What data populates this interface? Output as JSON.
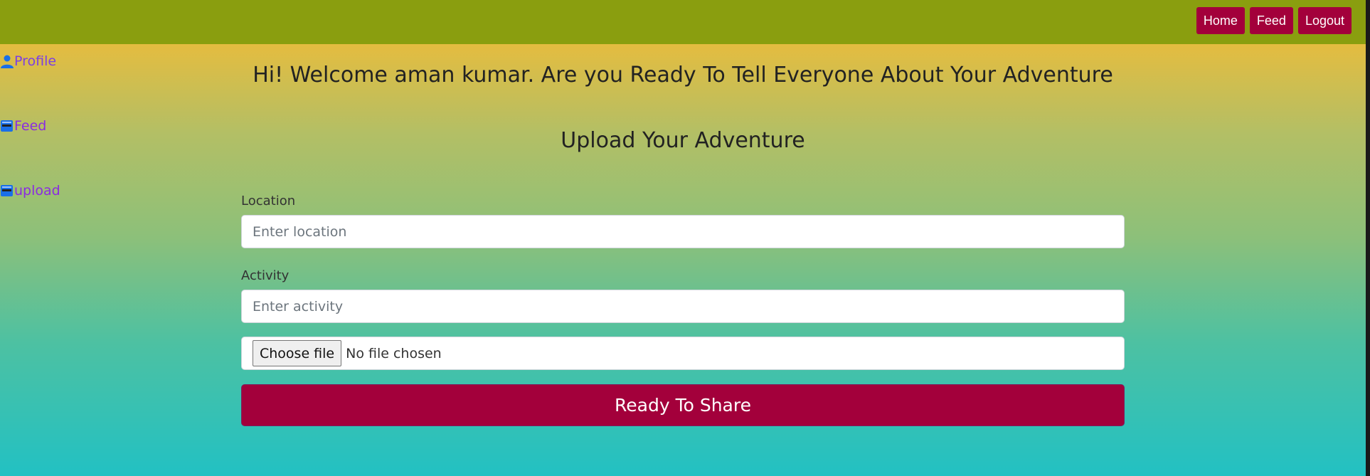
{
  "header": {
    "nav": [
      {
        "label": "Home"
      },
      {
        "label": "Feed"
      },
      {
        "label": "Logout"
      }
    ]
  },
  "sidebar": {
    "items": [
      {
        "label": "Profile",
        "icon": "user-icon"
      },
      {
        "label": "Feed",
        "icon": "feed-icon"
      },
      {
        "label": "upload",
        "icon": "upload-icon"
      }
    ]
  },
  "main": {
    "welcome": "Hi! Welcome aman kumar. Are you Ready To Tell Everyone About Your Adventure",
    "title": "Upload Your Adventure"
  },
  "form": {
    "location_label": "Location",
    "location_placeholder": "Enter location",
    "activity_label": "Activity",
    "activity_placeholder": "Enter activity",
    "file_button": "Choose file",
    "file_status": "No file chosen",
    "submit": "Ready To Share"
  },
  "colors": {
    "topbar": "#8a9e0f",
    "button": "#a3003b",
    "gradient_top": "#fdbb2d",
    "gradient_bottom": "#22c1c3",
    "link": "#8a2be2"
  }
}
